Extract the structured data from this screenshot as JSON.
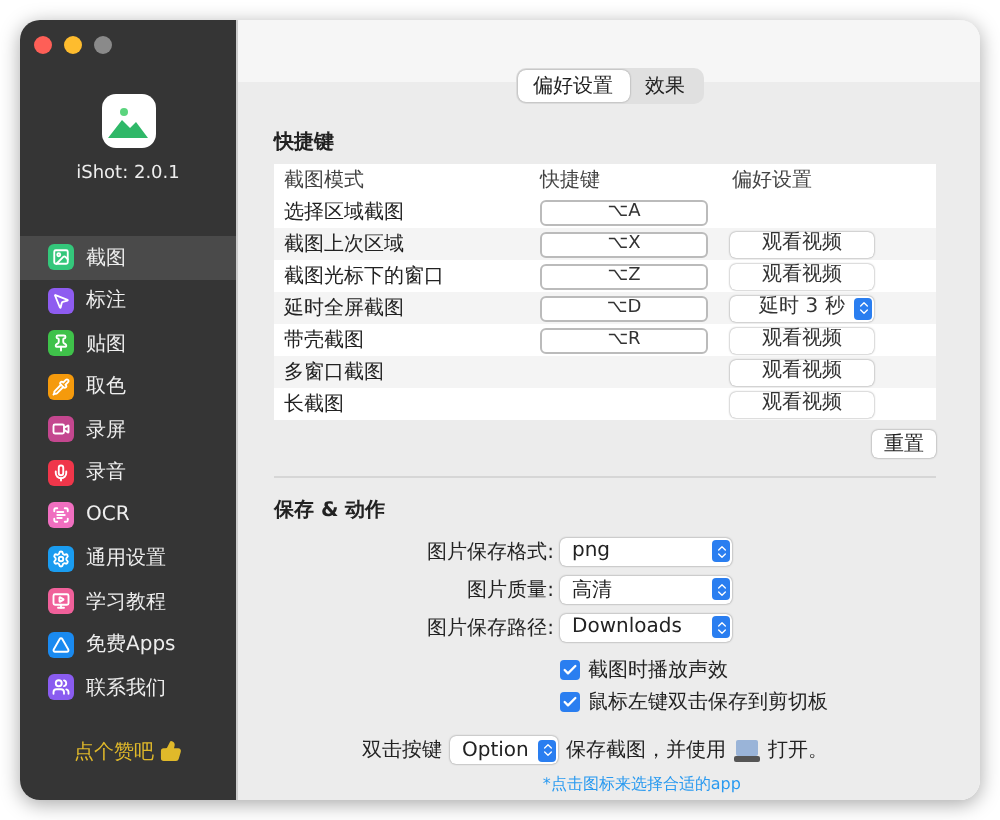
{
  "app": {
    "version": "iShot: 2.0.1"
  },
  "sidebar": {
    "items": [
      {
        "label": "截图",
        "selected": true,
        "color": "#34c77b"
      },
      {
        "label": "标注",
        "selected": false,
        "color": "#8e5cf0"
      },
      {
        "label": "贴图",
        "selected": false,
        "color": "#3fc24a"
      },
      {
        "label": "取色",
        "selected": false,
        "color": "#f59a0c"
      },
      {
        "label": "录屏",
        "selected": false,
        "color": "#c4478f"
      },
      {
        "label": "录音",
        "selected": false,
        "color": "#f0364a"
      },
      {
        "label": "OCR",
        "selected": false,
        "color": "#f06fc0"
      },
      {
        "label": "通用设置",
        "selected": false,
        "color": "#1a9cf0"
      },
      {
        "label": "学习教程",
        "selected": false,
        "color": "#f0609a"
      },
      {
        "label": "免费Apps",
        "selected": false,
        "color": "#1a8af0"
      },
      {
        "label": "联系我们",
        "selected": false,
        "color": "#8a5cf0"
      }
    ],
    "like": "点个赞吧"
  },
  "tabs": [
    {
      "label": "偏好设置",
      "selected": true
    },
    {
      "label": "效果",
      "selected": false
    }
  ],
  "shortcuts": {
    "title": "快捷键",
    "columns": [
      "截图模式",
      "快捷键",
      "偏好设置"
    ],
    "rows": [
      {
        "name": "选择区域截图",
        "shortcut": "⌥A",
        "pref": {
          "kind": "none"
        }
      },
      {
        "name": "截图上次区域",
        "shortcut": "⌥X",
        "pref": {
          "kind": "button",
          "label": "观看视频"
        }
      },
      {
        "name": "截图光标下的窗口",
        "shortcut": "⌥Z",
        "pref": {
          "kind": "button",
          "label": "观看视频"
        }
      },
      {
        "name": "延时全屏截图",
        "shortcut": "⌥D",
        "pref": {
          "kind": "select",
          "label": "延时 3 秒"
        }
      },
      {
        "name": "带壳截图",
        "shortcut": "⌥R",
        "pref": {
          "kind": "button",
          "label": "观看视频"
        }
      },
      {
        "name": "多窗口截图",
        "pref": {
          "kind": "button",
          "label": "观看视频"
        }
      },
      {
        "name": "长截图",
        "pref": {
          "kind": "button",
          "label": "观看视频"
        }
      }
    ],
    "reset": "重置"
  },
  "save": {
    "title": "保存 & 动作",
    "fields": [
      {
        "label": "图片保存格式:",
        "value": "png"
      },
      {
        "label": "图片质量:",
        "value": "高清"
      },
      {
        "label": "图片保存路径:",
        "value": "Downloads"
      }
    ],
    "checkboxes": [
      {
        "label": "截图时播放声效",
        "checked": true
      },
      {
        "label": "鼠标左键双击保存到剪切板",
        "checked": true
      }
    ],
    "double_click": {
      "label": "双击按键",
      "value": "Option",
      "text": "保存截图，并使用",
      "after": "打开。"
    },
    "hint": "*点击图标来选择合适的app"
  }
}
